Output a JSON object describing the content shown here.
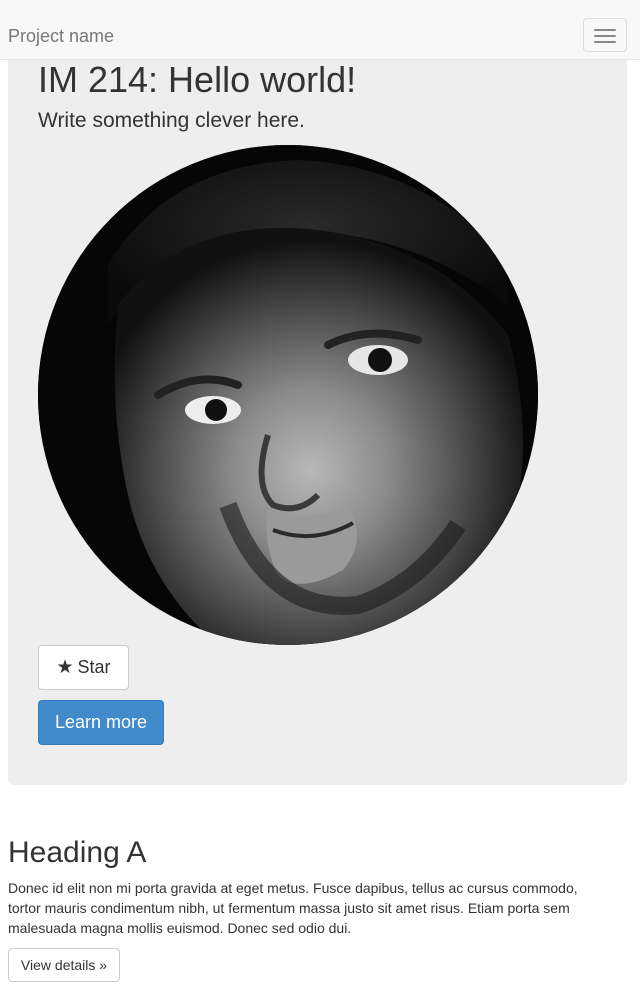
{
  "navbar": {
    "brand": "Project name",
    "toggle_icon": "hamburger-menu-icon"
  },
  "jumbotron": {
    "title": "IM 214: Hello world!",
    "subtitle": "Write something clever here.",
    "portrait_icon": "portrait-photo",
    "star_button": {
      "icon": "★",
      "label": "Star"
    },
    "learn_more_label": "Learn more"
  },
  "section": {
    "heading": "Heading A",
    "body": "Donec id elit non mi porta gravida at eget metus. Fusce dapibus, tellus ac cursus commodo, tortor mauris condimentum nibh, ut fermentum massa justo sit amet risus. Etiam porta sem malesuada magna mollis euismod. Donec sed odio dui.",
    "details_label": "View details »"
  },
  "colors": {
    "navbar_bg": "#f8f8f8",
    "jumbotron_bg": "#eeeeee",
    "primary": "#428bca",
    "text": "#333333"
  }
}
